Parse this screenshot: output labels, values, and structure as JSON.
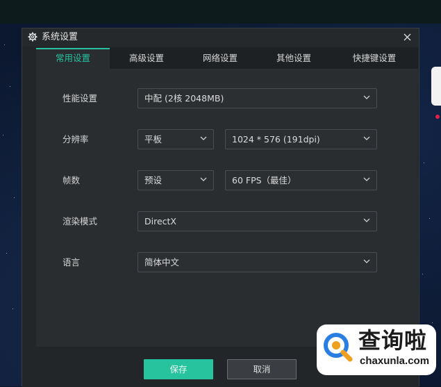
{
  "dialog": {
    "title": "系统设置",
    "close_glyph": "✕"
  },
  "tabs": [
    {
      "label": "常用设置",
      "active": true
    },
    {
      "label": "高级设置",
      "active": false
    },
    {
      "label": "网络设置",
      "active": false
    },
    {
      "label": "其他设置",
      "active": false
    },
    {
      "label": "快捷键设置",
      "active": false
    }
  ],
  "settings": {
    "performance": {
      "label": "性能设置",
      "value": "中配 (2核 2048MB)"
    },
    "resolution": {
      "label": "分辨率",
      "mode": "平板",
      "value": "1024 * 576 (191dpi)"
    },
    "fps": {
      "label": "帧数",
      "mode": "预设",
      "value": "60 FPS（最佳）"
    },
    "render": {
      "label": "渲染模式",
      "value": "DirectX"
    },
    "language": {
      "label": "语言",
      "value": "简体中文"
    }
  },
  "footer": {
    "save_label": "保存",
    "cancel_label": "取消"
  },
  "watermark": {
    "brand": "查询啦",
    "url": "chaxunla.com"
  },
  "colors": {
    "accent": "#25c1a0",
    "dialog_bg": "#2a2d30"
  }
}
